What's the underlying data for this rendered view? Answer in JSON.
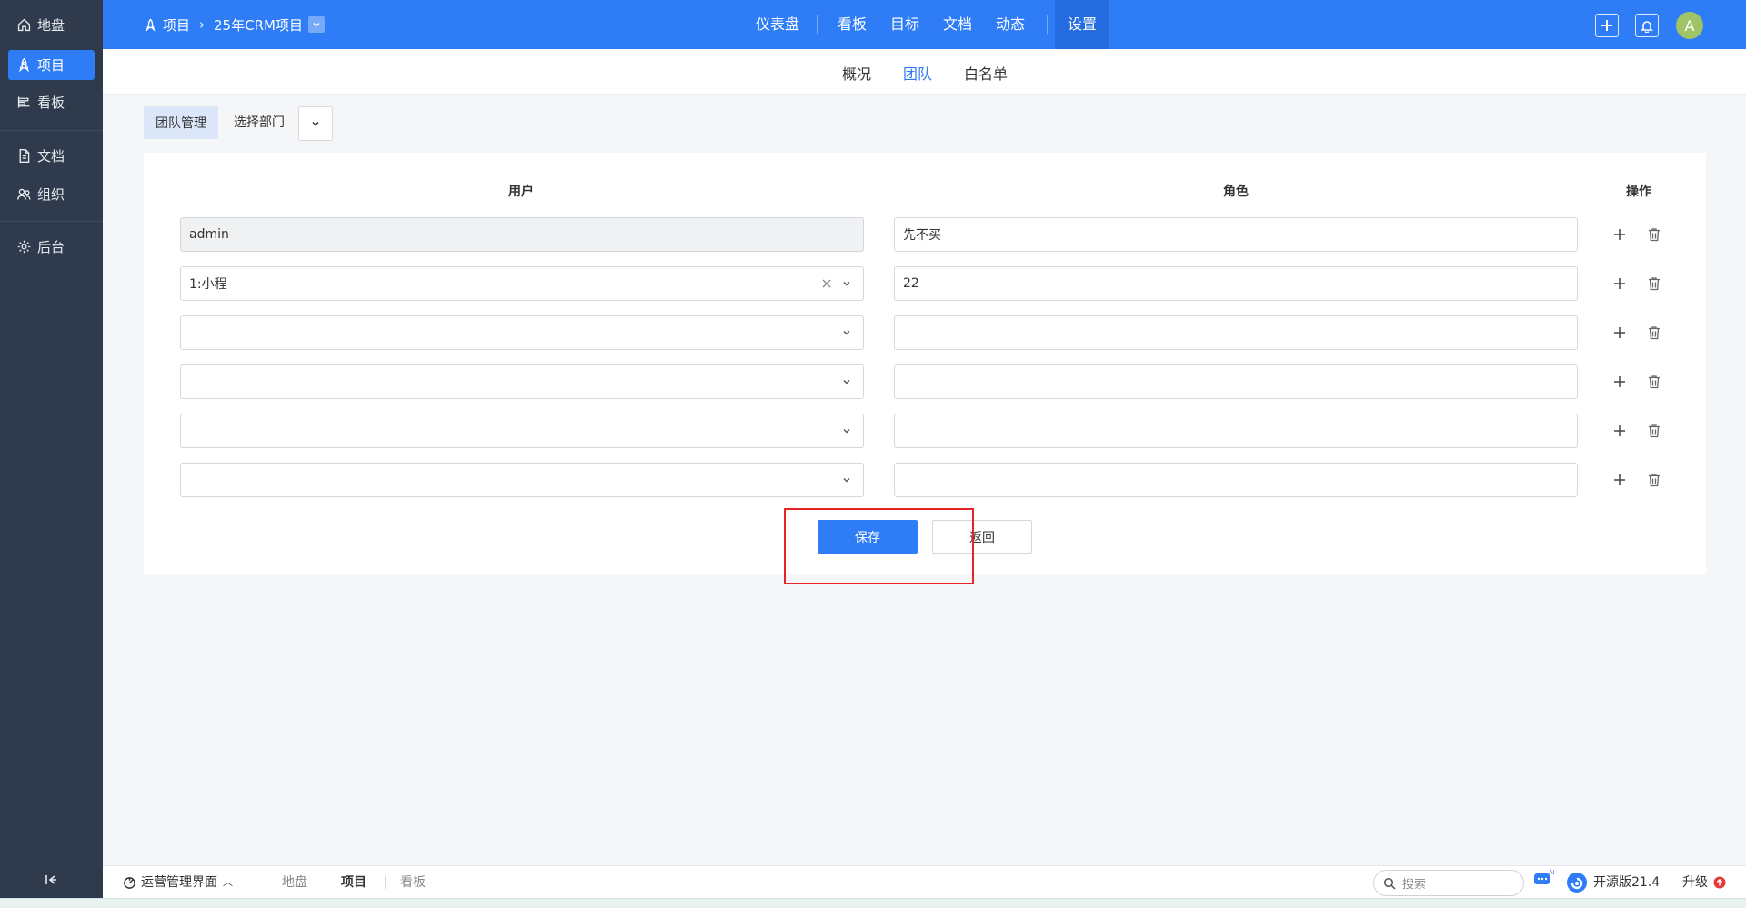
{
  "sidebar": {
    "items": [
      {
        "label": "地盘",
        "icon": "home-icon"
      },
      {
        "label": "项目",
        "icon": "rocket-icon",
        "active": true
      },
      {
        "label": "看板",
        "icon": "kanban-icon"
      },
      {
        "label": "文档",
        "icon": "document-icon"
      },
      {
        "label": "组织",
        "icon": "users-icon"
      },
      {
        "label": "后台",
        "icon": "gear-icon"
      }
    ]
  },
  "topbar": {
    "breadcrumb_root": "项目",
    "breadcrumb_project": "25年CRM项目",
    "nav": [
      "仪表盘",
      "看板",
      "目标",
      "文档",
      "动态",
      "设置"
    ],
    "active_nav": "设置",
    "avatar_letter": "A",
    "accent_color": "#2e7cf6"
  },
  "subtabs": {
    "items": [
      "概况",
      "团队",
      "白名单"
    ],
    "active": "团队"
  },
  "toolbar": {
    "team_mgmt": "团队管理",
    "dept_label": "选择部门"
  },
  "table": {
    "headers": {
      "user": "用户",
      "role": "角色",
      "ops": "操作"
    },
    "rows": [
      {
        "user": "admin",
        "role": "先不买"
      },
      {
        "user": "1:小程",
        "role": "22"
      },
      {
        "user": "",
        "role": ""
      },
      {
        "user": "",
        "role": ""
      },
      {
        "user": "",
        "role": ""
      },
      {
        "user": "",
        "role": ""
      }
    ]
  },
  "actions": {
    "save": "保存",
    "back": "返回"
  },
  "bottombar": {
    "workspace": "运营管理界面",
    "tabs": [
      "地盘",
      "项目",
      "看板"
    ],
    "active_tab": "项目",
    "search_placeholder": "搜索",
    "version": "开源版21.4",
    "upgrade": "升级"
  }
}
